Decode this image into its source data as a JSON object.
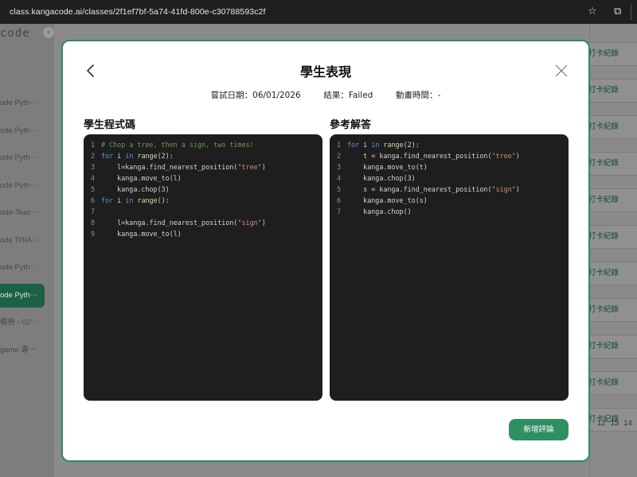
{
  "browser": {
    "url": "class.kangacode.ai/classes/2f1ef7bf-5a74-41fd-800e-c30788593c2f"
  },
  "sidebar": {
    "logo": "code",
    "items": [
      {
        "label": "ode Pyth⋯"
      },
      {
        "label": "ode Pyth⋯"
      },
      {
        "label": "ode Pyth⋯"
      },
      {
        "label": "ode Pyth⋯"
      },
      {
        "label": "ode-Teac⋯"
      },
      {
        "label": "ode TRIA⋯"
      },
      {
        "label": "ode Pyth⋯"
      },
      {
        "label": "ode Pyth⋯"
      },
      {
        "label": "備營 - 02⋯"
      },
      {
        "label": "game 專⋯"
      }
    ]
  },
  "background": {
    "row_button_label": "打卡紀錄",
    "pages": [
      "12",
      "13",
      "14"
    ]
  },
  "modal": {
    "title": "學生表現",
    "attempt_date_label": "嘗試日期：",
    "attempt_date_value": "06/01/2026",
    "result_label": "結果：",
    "result_value": "Failed",
    "anim_time_label": "動畫時間：",
    "anim_time_value": "-",
    "student_code_title": "學生程式碼",
    "reference_title": "參考解答",
    "add_comment_label": "新增評論",
    "student_code": [
      "# Chop a tree, then a sign, two times!",
      "for i in range(2):",
      "    l=kanga.find_nearest_position(\"tree\")",
      "    kanga.move_to(l)",
      "    kanga.chop(3)",
      "for i in range():",
      "",
      "    l=kanga.find_nearest_position(\"sign\")",
      "    kanga.move_to(l)"
    ],
    "reference_code": [
      "for i in range(2):",
      "    t = kanga.find_nearest_position(\"tree\")",
      "    kanga.move_to(t)",
      "    kanga.chop(3)",
      "    s = kanga.find_nearest_position(\"sign\")",
      "    kanga.move_to(s)",
      "    kanga.chop()"
    ]
  },
  "colors": {
    "accent": "#2f8f63",
    "code_bg": "#1e1e1e",
    "comment": "#6a9955",
    "keyword": "#569cd6",
    "function": "#dcdcaa",
    "string": "#ce9178"
  }
}
